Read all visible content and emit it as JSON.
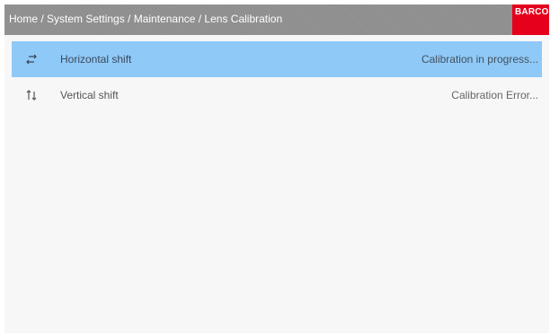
{
  "header": {
    "breadcrumb": "Home / System Settings / Maintenance / Lens Calibration",
    "logo_text": "BARCO",
    "logo_color": "#e5001c"
  },
  "list": {
    "items": [
      {
        "icon": "horizontal-shift-arrows-icon",
        "label": "Horizontal shift",
        "status": "Calibration in progress...",
        "selected": true
      },
      {
        "icon": "vertical-shift-arrows-icon",
        "label": "Vertical shift",
        "status": "Calibration Error...",
        "selected": false
      }
    ]
  },
  "colors": {
    "header_bg": "#8e8e8e",
    "selected_row_bg": "#8fc9f8",
    "page_bg": "#f7f7f7"
  }
}
